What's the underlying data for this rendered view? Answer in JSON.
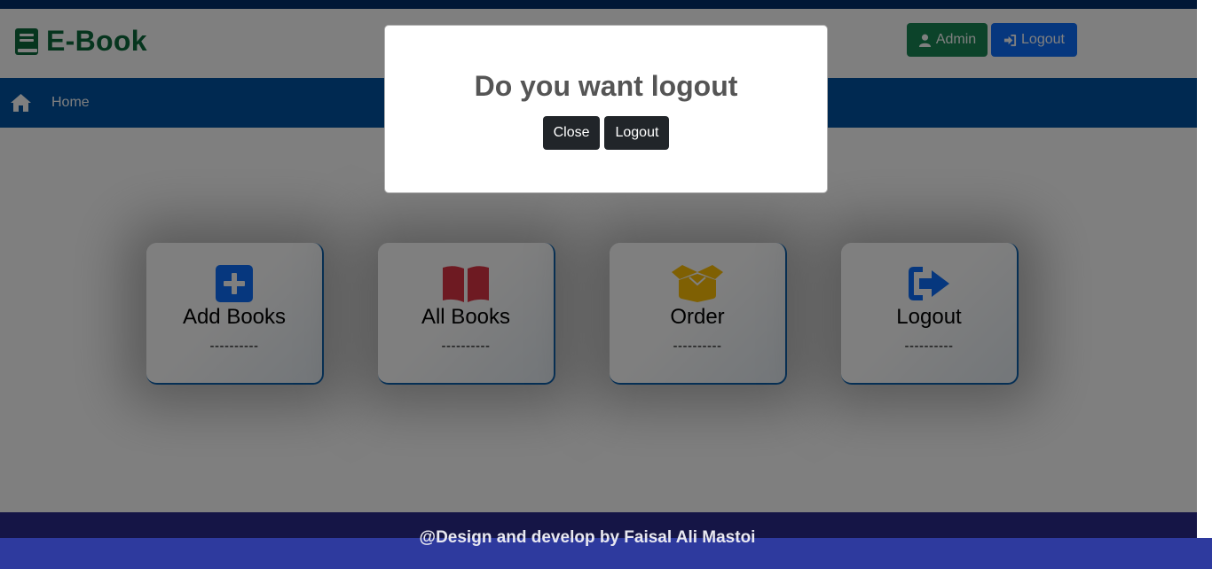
{
  "header": {
    "brand": "E-Book",
    "admin_label": "Admin",
    "logout_label": "Logout"
  },
  "nav": {
    "home_label": "Home"
  },
  "cards": [
    {
      "title": "Add Books",
      "dashes": "----------",
      "icon": "plus-square-icon",
      "color": "#0d6efd"
    },
    {
      "title": "All Books",
      "dashes": "----------",
      "icon": "book-open-icon",
      "color": "#dc3545"
    },
    {
      "title": "Order",
      "dashes": "----------",
      "icon": "box-open-icon",
      "color": "#ffc107"
    },
    {
      "title": "Logout",
      "dashes": "----------",
      "icon": "sign-out-icon",
      "color": "#0d6efd"
    }
  ],
  "modal": {
    "title": "Do you want logout",
    "close_label": "Close",
    "logout_label": "Logout"
  },
  "footer": {
    "text": "@Design and develop by Faisal Ali Mastoi"
  },
  "colors": {
    "brand_green": "#0c6b3c",
    "admin_green": "#198754",
    "primary_blue": "#0d6efd",
    "nav_blue": "#0052a3",
    "footer_indigo": "#2e3a9e",
    "dark_button": "#212529"
  }
}
